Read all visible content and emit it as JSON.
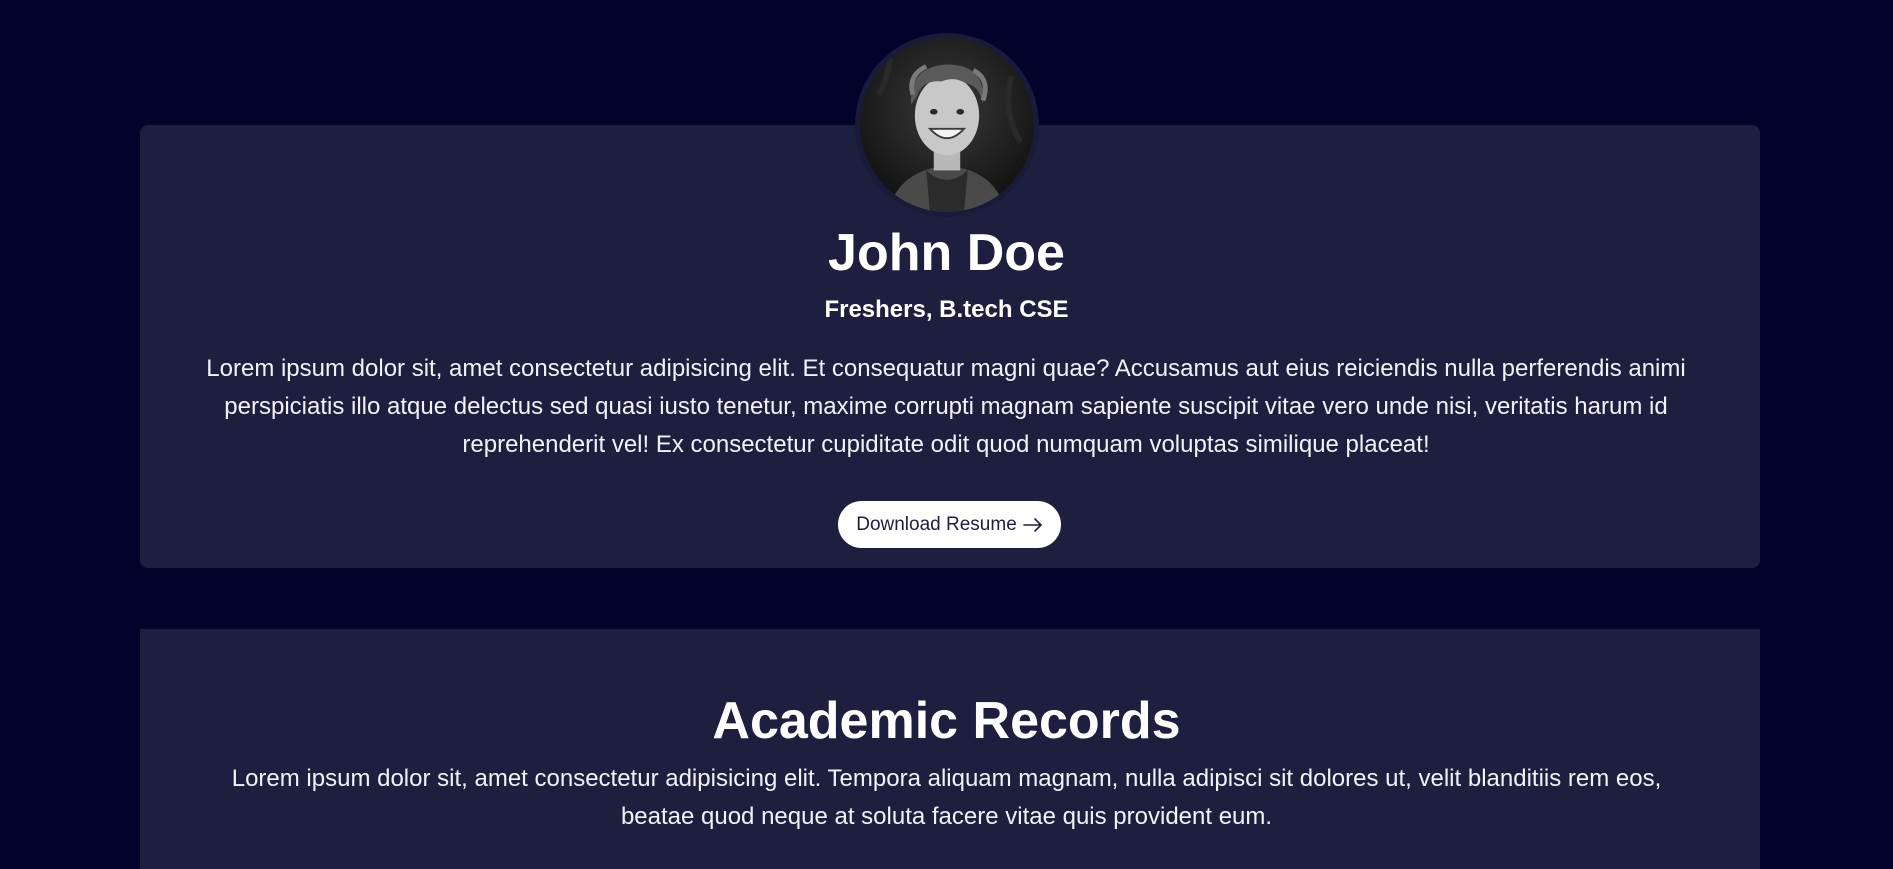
{
  "profile": {
    "name": "John Doe",
    "role": "Freshers, B.tech CSE",
    "bio": "Lorem ipsum dolor sit, amet consectetur adipisicing elit. Et consequatur magni quae? Accusamus aut eius reiciendis nulla perferendis animi perspiciatis illo atque delectus sed quasi iusto tenetur, maxime corrupti magnam sapiente suscipit vitae vero unde nisi, veritatis harum id reprehenderit vel! Ex consectetur cupiditate odit quod numquam voluptas similique placeat!",
    "button_label": "Download Resume",
    "button_icon": "arrow-right-icon",
    "avatar_icon": "avatar-photo"
  },
  "academic": {
    "title": "Academic Records",
    "description": "Lorem ipsum dolor sit, amet consectetur adipisicing elit. Tempora aliquam magnam, nulla adipisci sit dolores ut, velit blanditiis rem eos, beatae quod neque at soluta facere vitae quis provident eum."
  },
  "colors": {
    "background": "#02022a",
    "card": "#1e1e3f",
    "text": "#ffffff",
    "button_bg": "#ffffff",
    "button_text": "#1e1e3f"
  }
}
